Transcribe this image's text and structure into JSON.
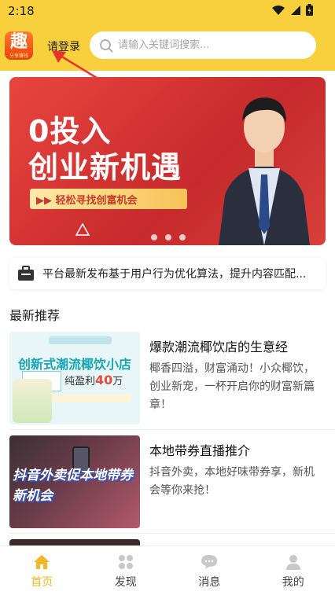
{
  "status_bar": {
    "time": "2:18"
  },
  "header": {
    "logo_char": "趣",
    "logo_sub": "分享赚钱",
    "login_label": "请登录",
    "search_placeholder": "请输入关键词搜索..."
  },
  "banner": {
    "line1": "0投入",
    "line2": "创业新机遇",
    "pill": "▶▶ 轻松寻找创富机会",
    "page_count": 3
  },
  "notice": {
    "text": "平台最新发布基于用户行为优化算法，提升内容匹配..."
  },
  "section_title": "最新推荐",
  "items": [
    {
      "title": "爆款潮流椰饮店的生意经",
      "desc": "椰香四溢，财富涌动！小众椰饮，创业新宠，一杯开启你的财富新篇章！",
      "thumb_headline": "创新式潮流椰饮小店",
      "thumb_money_prefix": "纯盈利",
      "thumb_money_value": "40",
      "thumb_money_unit": "万"
    },
    {
      "title": "本地带券直播推介",
      "desc": "抖音外卖，本地好味带券享，新机会等你来抢！",
      "thumb_line1": "抖音外卖促本地带券",
      "thumb_line2": "新机会"
    }
  ],
  "nav": [
    {
      "label": "首页",
      "icon": "home-icon",
      "active": true
    },
    {
      "label": "发现",
      "icon": "discover-icon",
      "active": false
    },
    {
      "label": "消息",
      "icon": "message-icon",
      "active": false
    },
    {
      "label": "我的",
      "icon": "profile-icon",
      "active": false
    }
  ],
  "colors": {
    "brand_yellow": "#f8cf3c",
    "active_tab": "#f0b82a",
    "banner_red": "#d8403b"
  }
}
